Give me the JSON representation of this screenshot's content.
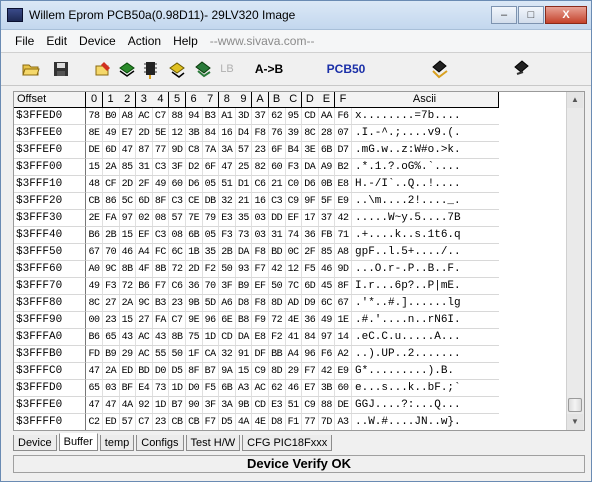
{
  "window": {
    "title": "Willem Eprom PCB50a(0.98D11)- 29LV320 Image",
    "minimize": "–",
    "maximize": "□",
    "close": "X"
  },
  "menu": {
    "items": [
      "File",
      "Edit",
      "Device",
      "Action",
      "Help"
    ],
    "url": "--www.sivava.com--"
  },
  "toolbar": {
    "buttons": [
      {
        "icon": "open-folder-icon"
      },
      {
        "icon": "save-disk-icon"
      },
      {
        "icon": "auto-erase-icon"
      },
      {
        "icon": "read-chip-icon"
      },
      {
        "icon": "program-chip-icon"
      },
      {
        "icon": "verify-chip-icon"
      },
      {
        "icon": "blank-check-icon"
      }
    ],
    "lb_label": "LB",
    "atob_label": "A->B",
    "pcb_label": "PCB50",
    "right_icons": [
      "chip-config-icon",
      "chip-info-icon"
    ]
  },
  "grid": {
    "offset_header": "Offset",
    "hex_headers": [
      "0",
      "1",
      "2",
      "3",
      "4",
      "5",
      "6",
      "7",
      "8",
      "9",
      "A",
      "B",
      "C",
      "D",
      "E",
      "F"
    ],
    "ascii_header": "Ascii",
    "rows": [
      {
        "offset": "$3FFED0",
        "bytes": [
          "78",
          "B0",
          "A8",
          "AC",
          "C7",
          "88",
          "94",
          "B3",
          "A1",
          "3D",
          "37",
          "62",
          "95",
          "CD",
          "AA",
          "F6"
        ],
        "ascii": "x........=7b...."
      },
      {
        "offset": "$3FFEE0",
        "bytes": [
          "8E",
          "49",
          "E7",
          "2D",
          "5E",
          "12",
          "3B",
          "84",
          "16",
          "D4",
          "F8",
          "76",
          "39",
          "8C",
          "28",
          "07"
        ],
        "ascii": ".I.-^.;....v9.(."
      },
      {
        "offset": "$3FFEF0",
        "bytes": [
          "DE",
          "6D",
          "47",
          "87",
          "77",
          "9D",
          "C8",
          "7A",
          "3A",
          "57",
          "23",
          "6F",
          "B4",
          "3E",
          "6B",
          "D7"
        ],
        "ascii": ".mG.w..z:W#o.>k."
      },
      {
        "offset": "$3FFF00",
        "bytes": [
          "15",
          "2A",
          "85",
          "31",
          "C3",
          "3F",
          "D2",
          "6F",
          "47",
          "25",
          "82",
          "60",
          "F3",
          "DA",
          "A9",
          "B2"
        ],
        "ascii": ".*.1.?.oG%.`...."
      },
      {
        "offset": "$3FFF10",
        "bytes": [
          "48",
          "CF",
          "2D",
          "2F",
          "49",
          "60",
          "D6",
          "05",
          "51",
          "D1",
          "C6",
          "21",
          "C0",
          "D6",
          "0B",
          "E8"
        ],
        "ascii": "H.-/I`..Q..!...."
      },
      {
        "offset": "$3FFF20",
        "bytes": [
          "CB",
          "86",
          "5C",
          "6D",
          "8F",
          "C3",
          "CE",
          "DB",
          "32",
          "21",
          "16",
          "C3",
          "C9",
          "9F",
          "5F",
          "E9"
        ],
        "ascii": "..\\m....2!...._."
      },
      {
        "offset": "$3FFF30",
        "bytes": [
          "2E",
          "FA",
          "97",
          "02",
          "08",
          "57",
          "7E",
          "79",
          "E3",
          "35",
          "03",
          "DD",
          "EF",
          "17",
          "37",
          "42"
        ],
        "ascii": ".....W~y.5....7B"
      },
      {
        "offset": "$3FFF40",
        "bytes": [
          "B6",
          "2B",
          "15",
          "EF",
          "C3",
          "08",
          "6B",
          "05",
          "F3",
          "73",
          "03",
          "31",
          "74",
          "36",
          "FB",
          "71"
        ],
        "ascii": ".+....k..s.1t6.q"
      },
      {
        "offset": "$3FFF50",
        "bytes": [
          "67",
          "70",
          "46",
          "A4",
          "FC",
          "6C",
          "1B",
          "35",
          "2B",
          "DA",
          "F8",
          "BD",
          "0C",
          "2F",
          "85",
          "A8"
        ],
        "ascii": "gpF..l.5+..../.."
      },
      {
        "offset": "$3FFF60",
        "bytes": [
          "A0",
          "9C",
          "8B",
          "4F",
          "8B",
          "72",
          "2D",
          "F2",
          "50",
          "93",
          "F7",
          "42",
          "12",
          "F5",
          "46",
          "9D"
        ],
        "ascii": "...O.r-.P..B..F."
      },
      {
        "offset": "$3FFF70",
        "bytes": [
          "49",
          "F3",
          "72",
          "B6",
          "F7",
          "C6",
          "36",
          "70",
          "3F",
          "B9",
          "EF",
          "50",
          "7C",
          "6D",
          "45",
          "8F"
        ],
        "ascii": "I.r...6p?..P|mE."
      },
      {
        "offset": "$3FFF80",
        "bytes": [
          "8C",
          "27",
          "2A",
          "9C",
          "B3",
          "23",
          "9B",
          "5D",
          "A6",
          "D8",
          "F8",
          "8D",
          "AD",
          "D9",
          "6C",
          "67"
        ],
        "ascii": ".'*..#.]......lg"
      },
      {
        "offset": "$3FFF90",
        "bytes": [
          "00",
          "23",
          "15",
          "27",
          "FA",
          "C7",
          "9E",
          "96",
          "6E",
          "B8",
          "F9",
          "72",
          "4E",
          "36",
          "49",
          "1E"
        ],
        "ascii": ".#.'....n..rN6I."
      },
      {
        "offset": "$3FFFA0",
        "bytes": [
          "B6",
          "65",
          "43",
          "AC",
          "43",
          "8B",
          "75",
          "1D",
          "CD",
          "DA",
          "E8",
          "F2",
          "41",
          "84",
          "97",
          "14"
        ],
        "ascii": ".eC.C.u.....A..."
      },
      {
        "offset": "$3FFFB0",
        "bytes": [
          "FD",
          "B9",
          "29",
          "AC",
          "55",
          "50",
          "1F",
          "CA",
          "32",
          "91",
          "DF",
          "BB",
          "A4",
          "96",
          "F6",
          "A2"
        ],
        "ascii": "..).UP..2......."
      },
      {
        "offset": "$3FFFC0",
        "bytes": [
          "47",
          "2A",
          "ED",
          "BD",
          "D0",
          "D5",
          "8F",
          "B7",
          "9A",
          "15",
          "C9",
          "8D",
          "29",
          "F7",
          "42",
          "E9"
        ],
        "ascii": "G*.........).B."
      },
      {
        "offset": "$3FFFD0",
        "bytes": [
          "65",
          "03",
          "BF",
          "E4",
          "73",
          "1D",
          "D0",
          "F5",
          "6B",
          "A3",
          "AC",
          "62",
          "46",
          "E7",
          "3B",
          "60"
        ],
        "ascii": "e...s...k..bF.;`"
      },
      {
        "offset": "$3FFFE0",
        "bytes": [
          "47",
          "47",
          "4A",
          "92",
          "1D",
          "B7",
          "90",
          "3F",
          "3A",
          "9B",
          "CD",
          "E3",
          "51",
          "C9",
          "88",
          "DE"
        ],
        "ascii": "GGJ....?:...Q..."
      },
      {
        "offset": "$3FFFF0",
        "bytes": [
          "C2",
          "ED",
          "57",
          "C7",
          "23",
          "CB",
          "CB",
          "F7",
          "D5",
          "4A",
          "4E",
          "D8",
          "F1",
          "77",
          "7D",
          "A3"
        ],
        "ascii": "..W.#....JN..w}."
      }
    ]
  },
  "tabs": [
    "Device",
    "Buffer",
    "temp",
    "Configs",
    "Test H/W",
    "CFG PIC18Fxxx"
  ],
  "active_tab": "Buffer",
  "status": "Device Verify OK"
}
